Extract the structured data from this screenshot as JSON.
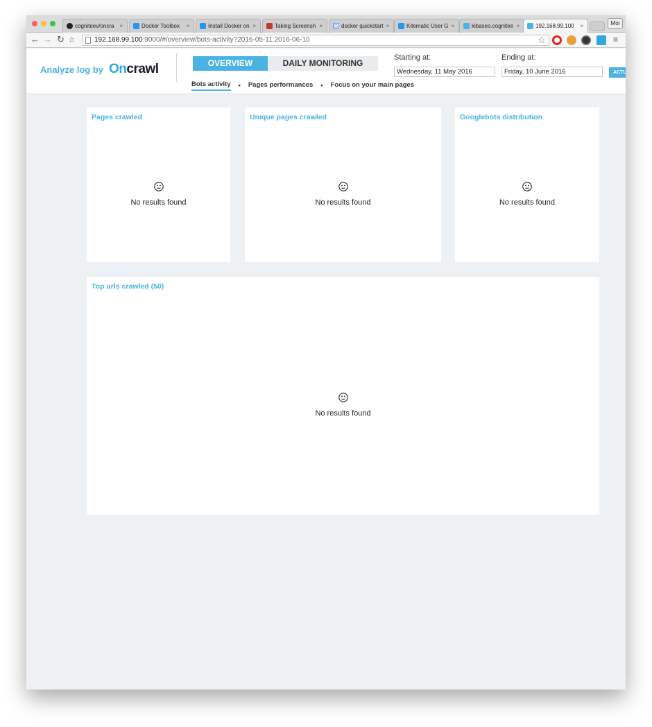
{
  "browser": {
    "tabs": [
      {
        "label": "cogniteev/oncra",
        "icon": "github-icon",
        "color": "#222222"
      },
      {
        "label": "Docker Toolbox",
        "icon": "docker-icon",
        "color": "#2496ed"
      },
      {
        "label": "Install Docker on",
        "icon": "docker-icon",
        "color": "#2496ed"
      },
      {
        "label": "Taking Screensh",
        "icon": "gitlab-icon",
        "color": "#c0392b"
      },
      {
        "label": "docker quickstart",
        "icon": "google-icon",
        "color": "#4285f4"
      },
      {
        "label": "Kitematic User G",
        "icon": "docker-icon",
        "color": "#2496ed"
      },
      {
        "label": "kibaseo.cognitee",
        "icon": "oncrawl-icon",
        "color": "#4ab3e2"
      },
      {
        "label": "192.168.99.100",
        "icon": "oncrawl-icon",
        "color": "#4ab3e2"
      }
    ],
    "tab_close": "×",
    "profile": "Moi",
    "url_host": "192.168.99.100",
    "url_path": ":9000/#/overview/bots-activity?2016-05-11:2016-06-10"
  },
  "header": {
    "brand_prefix": "Analyze log by",
    "logo_on": "On",
    "logo_crawl": "crawl",
    "tab_overview": "OVERVIEW",
    "tab_daily": "DAILY MONITORING",
    "subnav": [
      "Bots activity",
      "Pages performances",
      "Focus on your main pages"
    ],
    "subnav_sep": "•",
    "start_label": "Starting at:",
    "start_value": "Wednesday, 11 May 2016",
    "end_label": "Ending at:",
    "end_value": "Friday, 10 June 2016",
    "refresh_label": "ACTU"
  },
  "panels": {
    "pages_crawled": {
      "title": "Pages crawled",
      "empty": "No results found"
    },
    "unique_pages": {
      "title": "Unique pages crawled",
      "empty": "No results found"
    },
    "googlebots": {
      "title": "Googlebots distribution",
      "empty": "No results found"
    },
    "top_urls": {
      "title": "Top urls crawled (50)",
      "empty": "No results found"
    }
  },
  "colors": {
    "accent": "#4ab3e2",
    "background": "#eef1f4"
  }
}
